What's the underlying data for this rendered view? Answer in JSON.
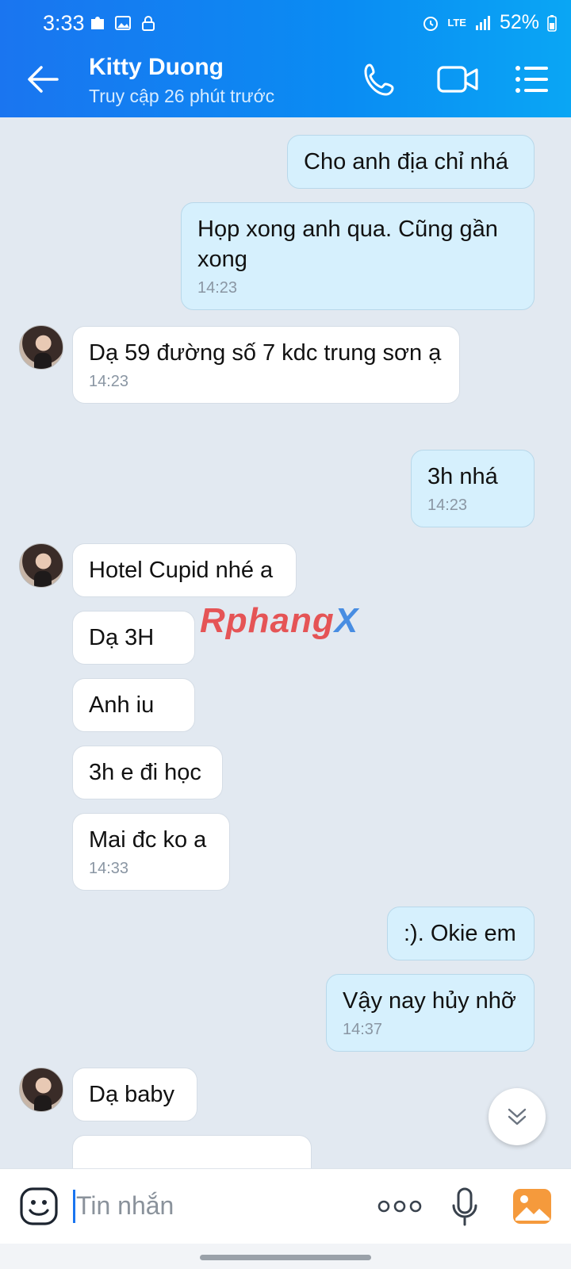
{
  "status_bar": {
    "time": "3:33",
    "network": "LTE",
    "battery": "52%"
  },
  "header": {
    "contact_name": "Kitty Duong",
    "last_seen": "Truy cập 26 phút trước"
  },
  "messages": [
    {
      "dir": "out",
      "text": "Cho anh địa chỉ nhá",
      "time": ""
    },
    {
      "dir": "out",
      "text": "Họp xong anh qua. Cũng gần xong",
      "time": "14:23"
    },
    {
      "dir": "in",
      "text": "Dạ 59 đường số 7 kdc trung sơn ạ",
      "time": "14:23"
    },
    {
      "dir": "out",
      "text": "3h nhá",
      "time": "14:23"
    },
    {
      "dir": "in",
      "text": "Hotel Cupid nhé a",
      "time": ""
    },
    {
      "dir": "in",
      "text": "Dạ 3H",
      "time": ""
    },
    {
      "dir": "in",
      "text": "Anh iu",
      "time": ""
    },
    {
      "dir": "in",
      "text": "3h e đi học",
      "time": ""
    },
    {
      "dir": "in",
      "text": "Mai đc ko a",
      "time": "14:33"
    },
    {
      "dir": "out",
      "text": ":). Okie em",
      "time": ""
    },
    {
      "dir": "out",
      "text": "Vậy nay hủy nhỡ",
      "time": "14:37"
    },
    {
      "dir": "in",
      "text": "Dạ baby",
      "time": ""
    }
  ],
  "watermark": {
    "part1": "Rphang",
    "part2": "X"
  },
  "composer": {
    "placeholder": "Tin nhắn"
  },
  "icons": {
    "back": "arrow-left-icon",
    "call": "phone-icon",
    "video": "video-camera-icon",
    "menu": "list-menu-icon",
    "emoji": "sticker-face-icon",
    "more": "more-dots-icon",
    "mic": "microphone-icon",
    "gallery": "image-gallery-icon",
    "scroll": "double-chevron-down-icon"
  },
  "colors": {
    "header": "#1a75f0",
    "outgoing_bubble": "#d6f0fd",
    "incoming_bubble": "#ffffff",
    "chat_bg": "#e2e9f1"
  }
}
